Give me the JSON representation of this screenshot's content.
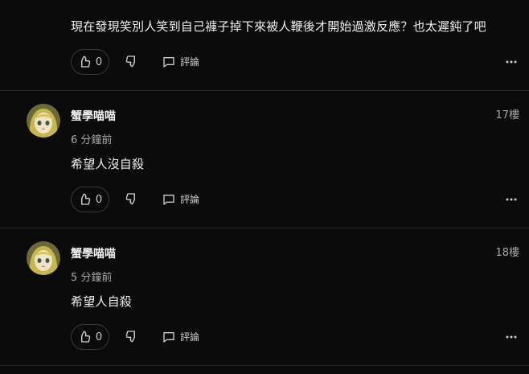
{
  "top_comment": {
    "text": "現在發現笑別人笑到自己褲子掉下來被人鞭後才開始過激反應？也太遲鈍了吧",
    "like_count": "0",
    "reply_label": "評論"
  },
  "comments": [
    {
      "author": "蟹學喵喵",
      "time": "6 分鐘前",
      "floor": "17樓",
      "text": "希望人沒自殺",
      "like_count": "0",
      "reply_label": "評論"
    },
    {
      "author": "蟹學喵喵",
      "time": "5 分鐘前",
      "floor": "18樓",
      "text": "希望人自殺",
      "like_count": "0",
      "reply_label": "評論"
    }
  ],
  "icons": {
    "like": "thumbs-up-icon",
    "dislike": "thumbs-down-icon",
    "reply": "comment-icon",
    "more": "more-horizontal-icon"
  },
  "colors": {
    "background": "#0b0b0b",
    "divider": "#2a2a2a",
    "text": "#efefef",
    "muted": "#a8a8a8"
  }
}
